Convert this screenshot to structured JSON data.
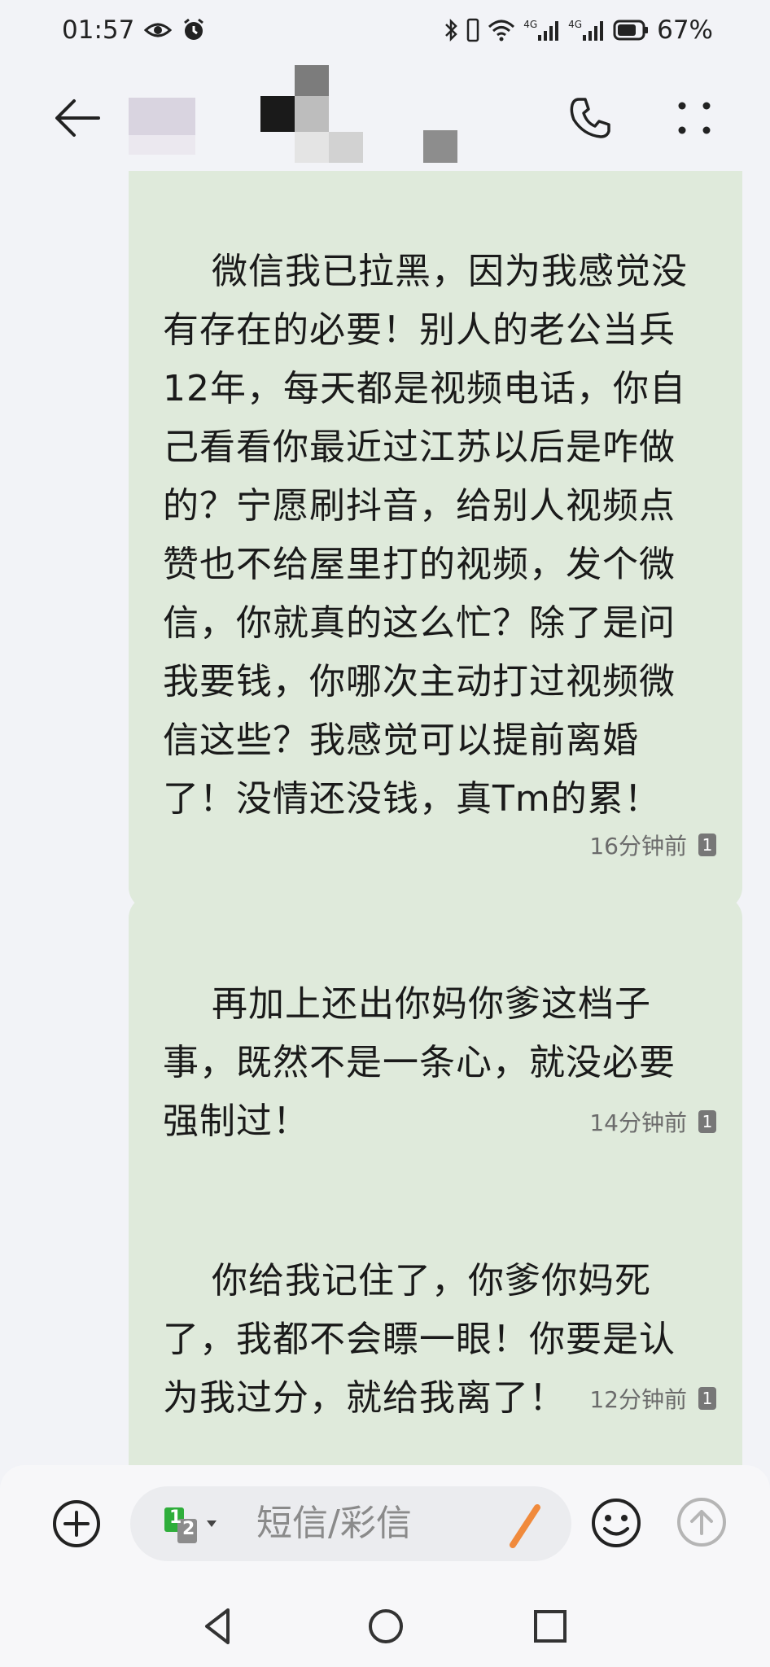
{
  "status_bar": {
    "time": "01:57",
    "network_1": "4G",
    "network_2": "4G",
    "battery": "67%"
  },
  "header": {
    "contact_name_visible": false
  },
  "messages": [
    {
      "text": "微信我已拉黑，因为我感觉没有存在的必要！别人的老公当兵12年，每天都是视频电话，你自己看看你最近过江苏以后是咋做的？宁愿刷抖音，给别人视频点赞也不给屋里打的视频，发个微信，你就真的这么忙？除了是问我要钱，你哪次主动打过视频微信这些？我感觉可以提前离婚了！没情还没钱，真Tm的累！",
      "time": "16分钟前",
      "sim": "1"
    },
    {
      "text": "再加上还出你妈你爹这档子事，既然不是一条心，就没必要强制过！",
      "time": "14分钟前",
      "sim": "1"
    },
    {
      "text": "你给我记住了，你爹你妈死了，我都不会瞟一眼！你要是认为我过分，就给我离了！",
      "time": "12分钟前",
      "sim": "1"
    }
  ],
  "composer": {
    "sim_primary": "1",
    "sim_secondary": "2",
    "placeholder": "短信/彩信"
  },
  "icons": {
    "status": [
      "eye-icon",
      "alarm-icon",
      "bluetooth-icon",
      "vibrate-icon",
      "wifi-icon",
      "signal-icon",
      "battery-icon"
    ],
    "header": [
      "back-arrow-icon",
      "phone-icon",
      "more-icon"
    ],
    "composer": [
      "add-icon",
      "sim-card-icon",
      "pen-icon",
      "emoji-icon",
      "send-icon"
    ],
    "nav": [
      "nav-back-icon",
      "nav-home-icon",
      "nav-recent-icon"
    ]
  },
  "colors": {
    "background": "#f2f3f7",
    "bubble": "#dfeadb",
    "accent_sim": "#2fae3b",
    "pen": "#f08a3c"
  }
}
